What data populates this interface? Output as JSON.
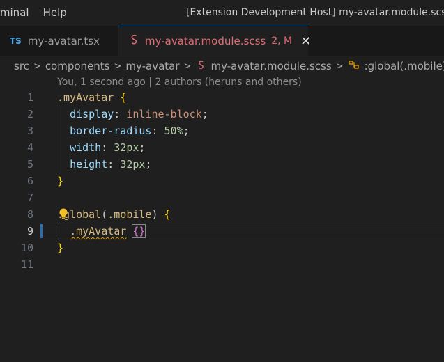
{
  "menubar": {
    "items": [
      "rminal",
      "Help"
    ]
  },
  "window": {
    "title": "[Extension Development Host] my-avatar.module.scss -"
  },
  "tabs": [
    {
      "icon": "TS",
      "label": "my-avatar.tsx",
      "active": false
    },
    {
      "icon": "scss-icon",
      "label": "my-avatar.module.scss",
      "status": "2, M",
      "close": "✕",
      "active": true
    }
  ],
  "breadcrumb": {
    "items": [
      "src",
      "components",
      "my-avatar",
      "my-avatar.module.scss",
      ":global(.mobile)"
    ],
    "separator": ">"
  },
  "blame": "You, 1 second ago | 2 authors (heruns and others)",
  "editor": {
    "current_line": 9,
    "lines": [
      {
        "num": "1",
        "text": ".myAvatar {"
      },
      {
        "num": "2",
        "text": "  display: inline-block;"
      },
      {
        "num": "3",
        "text": "  border-radius: 50%;"
      },
      {
        "num": "4",
        "text": "  width: 32px;"
      },
      {
        "num": "5",
        "text": "  height: 32px;"
      },
      {
        "num": "6",
        "text": "}"
      },
      {
        "num": "7",
        "text": ""
      },
      {
        "num": "8",
        "text": ":global(.mobile) {"
      },
      {
        "num": "9",
        "text": "  .myAvatar {}"
      },
      {
        "num": "10",
        "text": "}"
      },
      {
        "num": "11",
        "text": ""
      }
    ]
  },
  "colors": {
    "accent": "#0078d4",
    "modified_tab": "#e06c75",
    "selector": "#d7ba7d",
    "property": "#9cdcfe",
    "value": "#ce9178",
    "number": "#b5cea8",
    "brace": "#ffd700"
  }
}
